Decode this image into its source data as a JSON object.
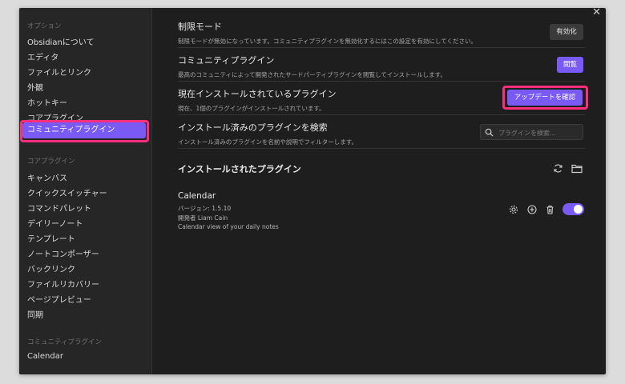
{
  "sidebar": {
    "options_heading": "オプション",
    "options_items": [
      "Obsidianについて",
      "エディタ",
      "ファイルとリンク",
      "外観",
      "ホットキー",
      "コアプラグイン"
    ],
    "active_item": "コミュニティプラグイン",
    "core_heading": "コアプラグイン",
    "core_items": [
      "キャンバス",
      "クイックスイッチャー",
      "コマンドパレット",
      "デイリーノート",
      "テンプレート",
      "ノートコンポーザー",
      "バックリンク",
      "ファイルリカバリー",
      "ページプレビュー",
      "同期"
    ],
    "community_heading": "コミュニティプラグイン",
    "community_items": [
      "Calendar"
    ]
  },
  "settings": {
    "restricted_mode": {
      "title": "制限モード",
      "desc": "制限モードが無効になっています。コミュニティプラグインを無効化するにはこの設定を有効にしてください。",
      "button": "有効化"
    },
    "community_plugins": {
      "title": "コミュニティプラグイン",
      "desc": "最高のコミュニティによって開発されたサードパーティプラグインを閲覧してインストールします。",
      "button": "閲覧"
    },
    "installed_plugins": {
      "title": "現在インストールされているプラグイン",
      "desc": "現在、1個のプラグインがインストールされています。",
      "button": "アップデートを確認"
    },
    "search_installed": {
      "title": "インストール済みのプラグインを検索",
      "desc": "インストール済みのプラグインを名前や説明でフィルターします。",
      "placeholder": "プラグインを検索..."
    }
  },
  "installed_section": {
    "heading": "インストールされたプラグイン"
  },
  "plugins": [
    {
      "name": "Calendar",
      "version": "バージョン: 1.5.10",
      "author": "開発者 Liam Cain",
      "description": "Calendar view of your daily notes",
      "enabled": true
    }
  ],
  "colors": {
    "accent": "#7a5af5",
    "highlight": "#ff2e7a"
  }
}
